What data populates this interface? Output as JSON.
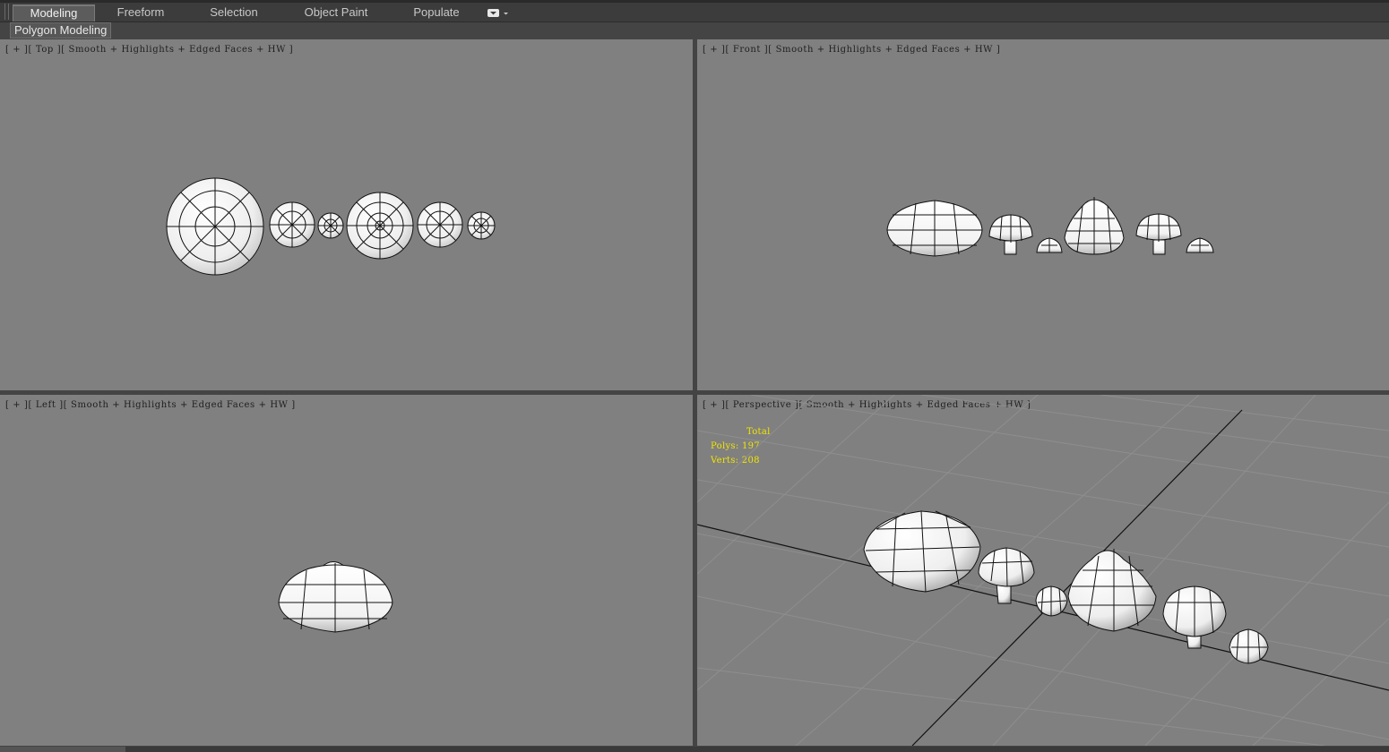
{
  "tabs": [
    {
      "label": "Modeling",
      "active": true
    },
    {
      "label": "Freeform",
      "active": false
    },
    {
      "label": "Selection",
      "active": false
    },
    {
      "label": "Object Paint",
      "active": false
    },
    {
      "label": "Populate",
      "active": false
    }
  ],
  "tab_extra_icon": "dropdown-menu-icon",
  "ribbon_panel": "Polygon Modeling",
  "viewports": {
    "top": {
      "label": "[ + ][ Top ][ Smooth + Highlights + Edged Faces + HW ]"
    },
    "front": {
      "label": "[ + ][ Front ][ Smooth + Highlights + Edged Faces + HW ]"
    },
    "left": {
      "label": "[ + ][ Left ][ Smooth + Highlights + Edged Faces + HW ]"
    },
    "persp": {
      "label": "[ + ][ Perspective ][ Smooth + Highlights + Edged Faces + HW ]"
    }
  },
  "stats": {
    "total_label": "Total",
    "polys": "Polys: 197",
    "verts": "Verts: 208"
  },
  "colors": {
    "viewport_bg": "#808080",
    "stats_text": "#f0e500",
    "ui_bg": "#444444"
  }
}
